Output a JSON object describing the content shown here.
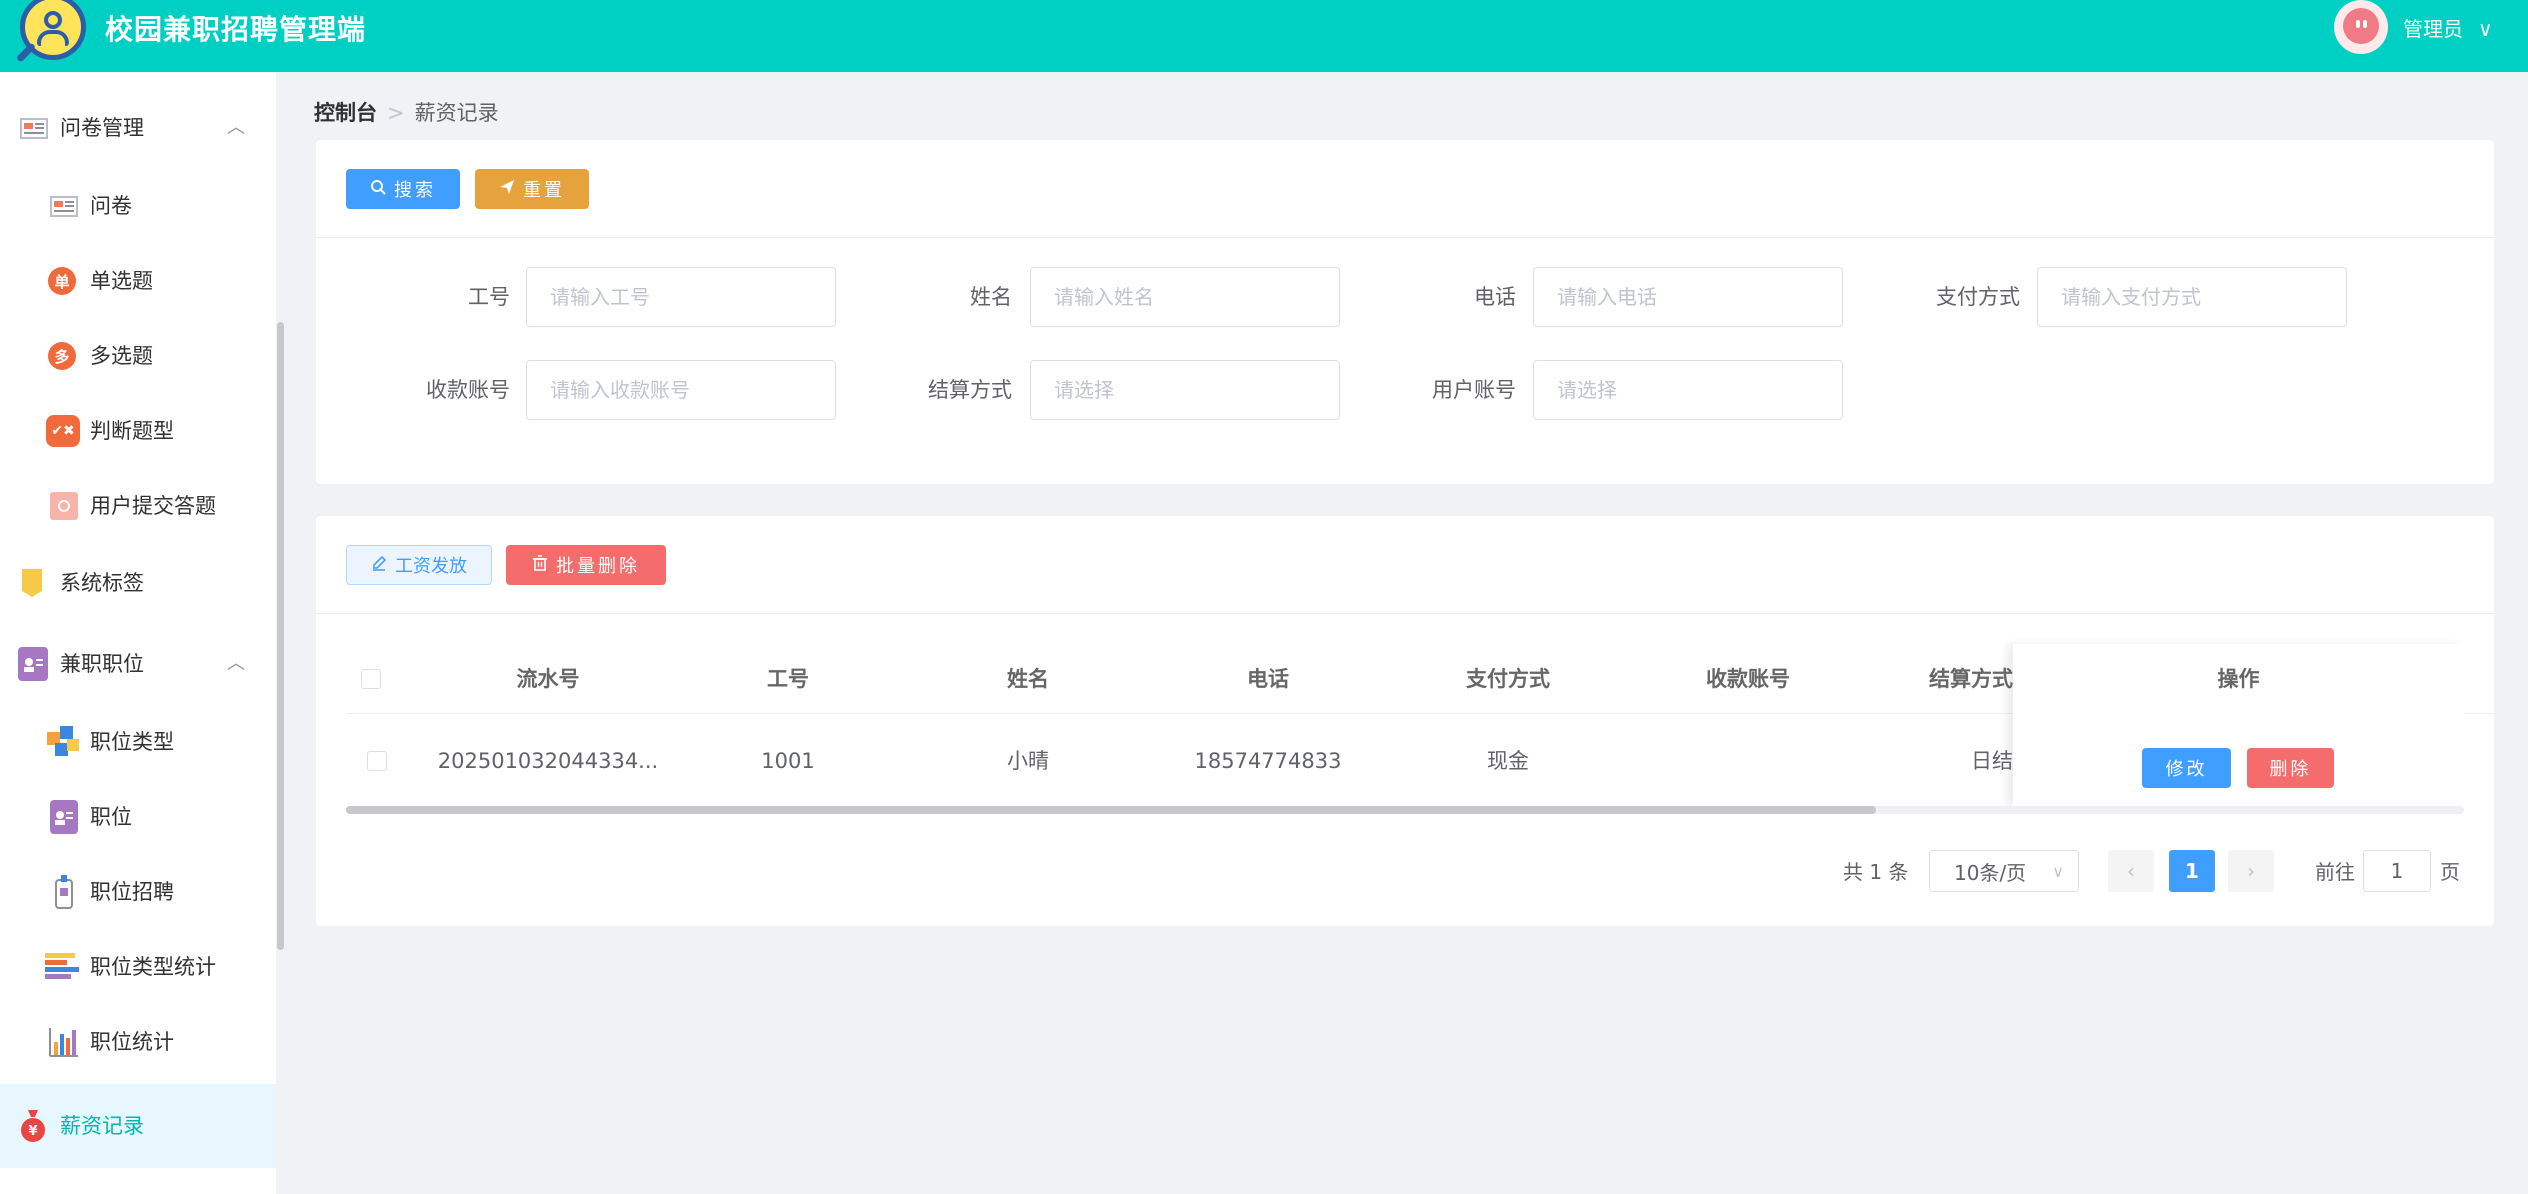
{
  "header": {
    "app_title": "校园兼职招聘管理端",
    "user_name": "管理员",
    "user_caret": "∨"
  },
  "sidebar": {
    "items": [
      {
        "label": "问卷管理",
        "chevron": "︿"
      },
      {
        "label": "问卷"
      },
      {
        "label": "单选题",
        "icon_text": "单"
      },
      {
        "label": "多选题",
        "icon_text": "多"
      },
      {
        "label": "判断题型"
      },
      {
        "label": "用户提交答题"
      },
      {
        "label": "系统标签"
      },
      {
        "label": "兼职职位",
        "chevron": "︿"
      },
      {
        "label": "职位类型"
      },
      {
        "label": "职位"
      },
      {
        "label": "职位招聘"
      },
      {
        "label": "职位类型统计"
      },
      {
        "label": "职位统计"
      },
      {
        "label": "薪资记录"
      }
    ]
  },
  "breadcrumb": {
    "home": "控制台",
    "sep": ">",
    "current": "薪资记录"
  },
  "search_buttons": {
    "search": "搜索",
    "reset": "重置"
  },
  "form": {
    "fields": [
      {
        "label": "工号",
        "placeholder": "请输入工号"
      },
      {
        "label": "姓名",
        "placeholder": "请输入姓名"
      },
      {
        "label": "电话",
        "placeholder": "请输入电话"
      },
      {
        "label": "支付方式",
        "placeholder": "请输入支付方式"
      },
      {
        "label": "收款账号",
        "placeholder": "请输入收款账号"
      },
      {
        "label": "结算方式",
        "placeholder": "请选择"
      },
      {
        "label": "用户账号",
        "placeholder": "请选择"
      }
    ]
  },
  "actions": {
    "pay": "工资发放",
    "batch_delete": "批量删除"
  },
  "table": {
    "columns": [
      "流水号",
      "工号",
      "姓名",
      "电话",
      "支付方式",
      "收款账号",
      "结算方式",
      "操作"
    ],
    "rows": [
      {
        "serial": "202501032044334...",
        "emp_no": "1001",
        "name": "小晴",
        "phone": "18574774833",
        "pay_method": "现金",
        "account": "",
        "settle": "日结",
        "edit_label": "修改",
        "delete_label": "删除"
      }
    ]
  },
  "pagination": {
    "total": "共 1 条",
    "page_size": "10条/页",
    "current_page": "1",
    "goto_prefix": "前往",
    "goto_value": "1",
    "goto_suffix": "页"
  },
  "colors": {
    "header_bg": "#00d0c4",
    "primary": "#409eff",
    "warning": "#e6a23c",
    "danger": "#f56c6c",
    "active_text": "#00b7b0"
  }
}
